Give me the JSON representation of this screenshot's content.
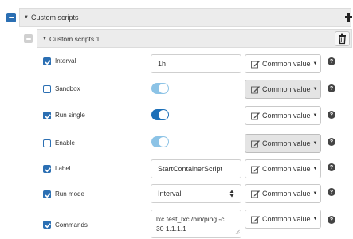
{
  "section": {
    "title": "Custom scripts"
  },
  "subsection": {
    "title": "Custom scripts 1"
  },
  "common_value_label": "Common value",
  "help_glyph": "?",
  "rows": [
    {
      "label": "Interval",
      "checked": true,
      "value": "1h"
    },
    {
      "label": "Sandbox",
      "checked": false,
      "toggle_on": true
    },
    {
      "label": "Run single",
      "checked": true,
      "toggle_on": true
    },
    {
      "label": "Enable",
      "checked": false,
      "toggle_on": true
    },
    {
      "label": "Label",
      "checked": true,
      "value": "StartContainerScript"
    },
    {
      "label": "Run mode",
      "checked": true,
      "value": "Interval"
    },
    {
      "label": "Commands",
      "checked": true,
      "value_line1": "lxc test_lxc /bin/ping -c",
      "value_line2": "30 1.1.1.1"
    }
  ],
  "colors": {
    "checkbox_blue": "#2b6fb3",
    "toggle_on": "#1b6fb8",
    "toggle_disabled": "#8cc3e6",
    "header_bg": "#ececec",
    "collapse_button": "#2b6fb3",
    "collapse_button_disabled": "#d0d0d0"
  },
  "icons": {
    "collapse": "minus-icon",
    "add": "plus-icon",
    "delete": "trash-icon",
    "edit": "edit-icon",
    "dropdown": "caret-down-icon",
    "help": "question-circle-icon",
    "select": "sort-arrows-icon"
  }
}
